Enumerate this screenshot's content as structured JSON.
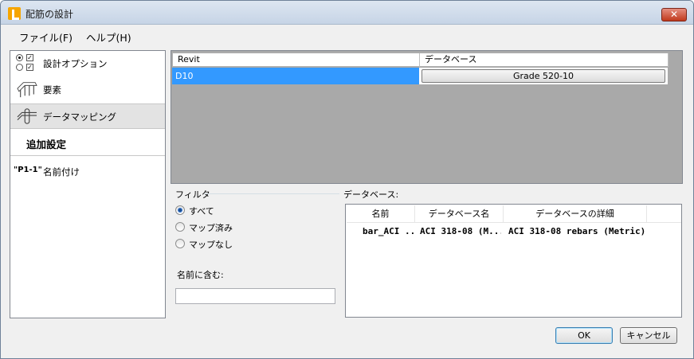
{
  "window": {
    "title": "配筋の設計",
    "close_glyph": "✕"
  },
  "menu": [
    {
      "label": "ファイル(F)"
    },
    {
      "label": "ヘルプ(H)"
    }
  ],
  "sidebar": {
    "items": [
      {
        "label": "設計オプション",
        "icon": "design-options-icon"
      },
      {
        "label": "要素",
        "icon": "elements-icon"
      },
      {
        "label": "データマッピング",
        "icon": "data-mapping-icon",
        "selected": true
      },
      {
        "label": "追加設定"
      },
      {
        "label": "名前付け",
        "icon_text": "\"P1-1\""
      }
    ]
  },
  "mapping_grid": {
    "columns": [
      "Revit",
      "データベース"
    ],
    "rows": [
      {
        "revit": "D10",
        "database": "Grade 520-10"
      }
    ]
  },
  "filter": {
    "title": "フィルタ",
    "options": [
      {
        "label": "すべて",
        "selected": true
      },
      {
        "label": "マップ済み",
        "selected": false
      },
      {
        "label": "マップなし",
        "selected": false
      }
    ],
    "name_contains_label": "名前に含む:",
    "name_contains_value": ""
  },
  "database": {
    "title": "データベース:",
    "columns": [
      "名前",
      "データベース名",
      "データベースの詳細"
    ],
    "rows": [
      {
        "name": "bar_ACI ...",
        "db_name": "ACI 318-08 (M...",
        "details": "ACI 318-08 rebars (Metric)"
      }
    ]
  },
  "buttons": {
    "ok": "OK",
    "cancel": "キャンセル"
  },
  "colors": {
    "selection": "#3399ff",
    "grid_background": "#a9a9a9",
    "app_icon": "#f6a500"
  }
}
